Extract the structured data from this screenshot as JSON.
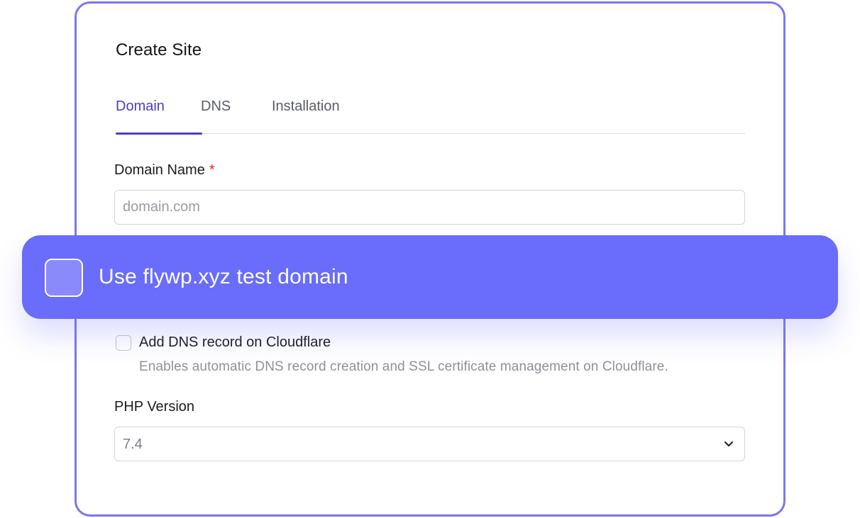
{
  "card": {
    "title": "Create Site",
    "tabs": [
      {
        "label": "Domain",
        "active": true
      },
      {
        "label": "DNS",
        "active": false
      },
      {
        "label": "Installation",
        "active": false
      }
    ]
  },
  "domain": {
    "label": "Domain Name",
    "required_mark": "*",
    "placeholder": "domain.com",
    "value": ""
  },
  "test_domain": {
    "label": "Use flywp.xyz test domain",
    "checked": false
  },
  "cloudflare": {
    "label": "Add DNS record on Cloudflare",
    "help": "Enables automatic DNS record creation and SSL certificate management on Cloudflare.",
    "checked": false
  },
  "php": {
    "label": "PHP Version",
    "selected": "7.4"
  },
  "colors": {
    "accent": "#4b3fc2",
    "banner": "#6a6cfb",
    "card_border": "#7b76f1",
    "required": "#dc2626"
  },
  "icons": {
    "select_arrow": "chevron-down-icon"
  }
}
